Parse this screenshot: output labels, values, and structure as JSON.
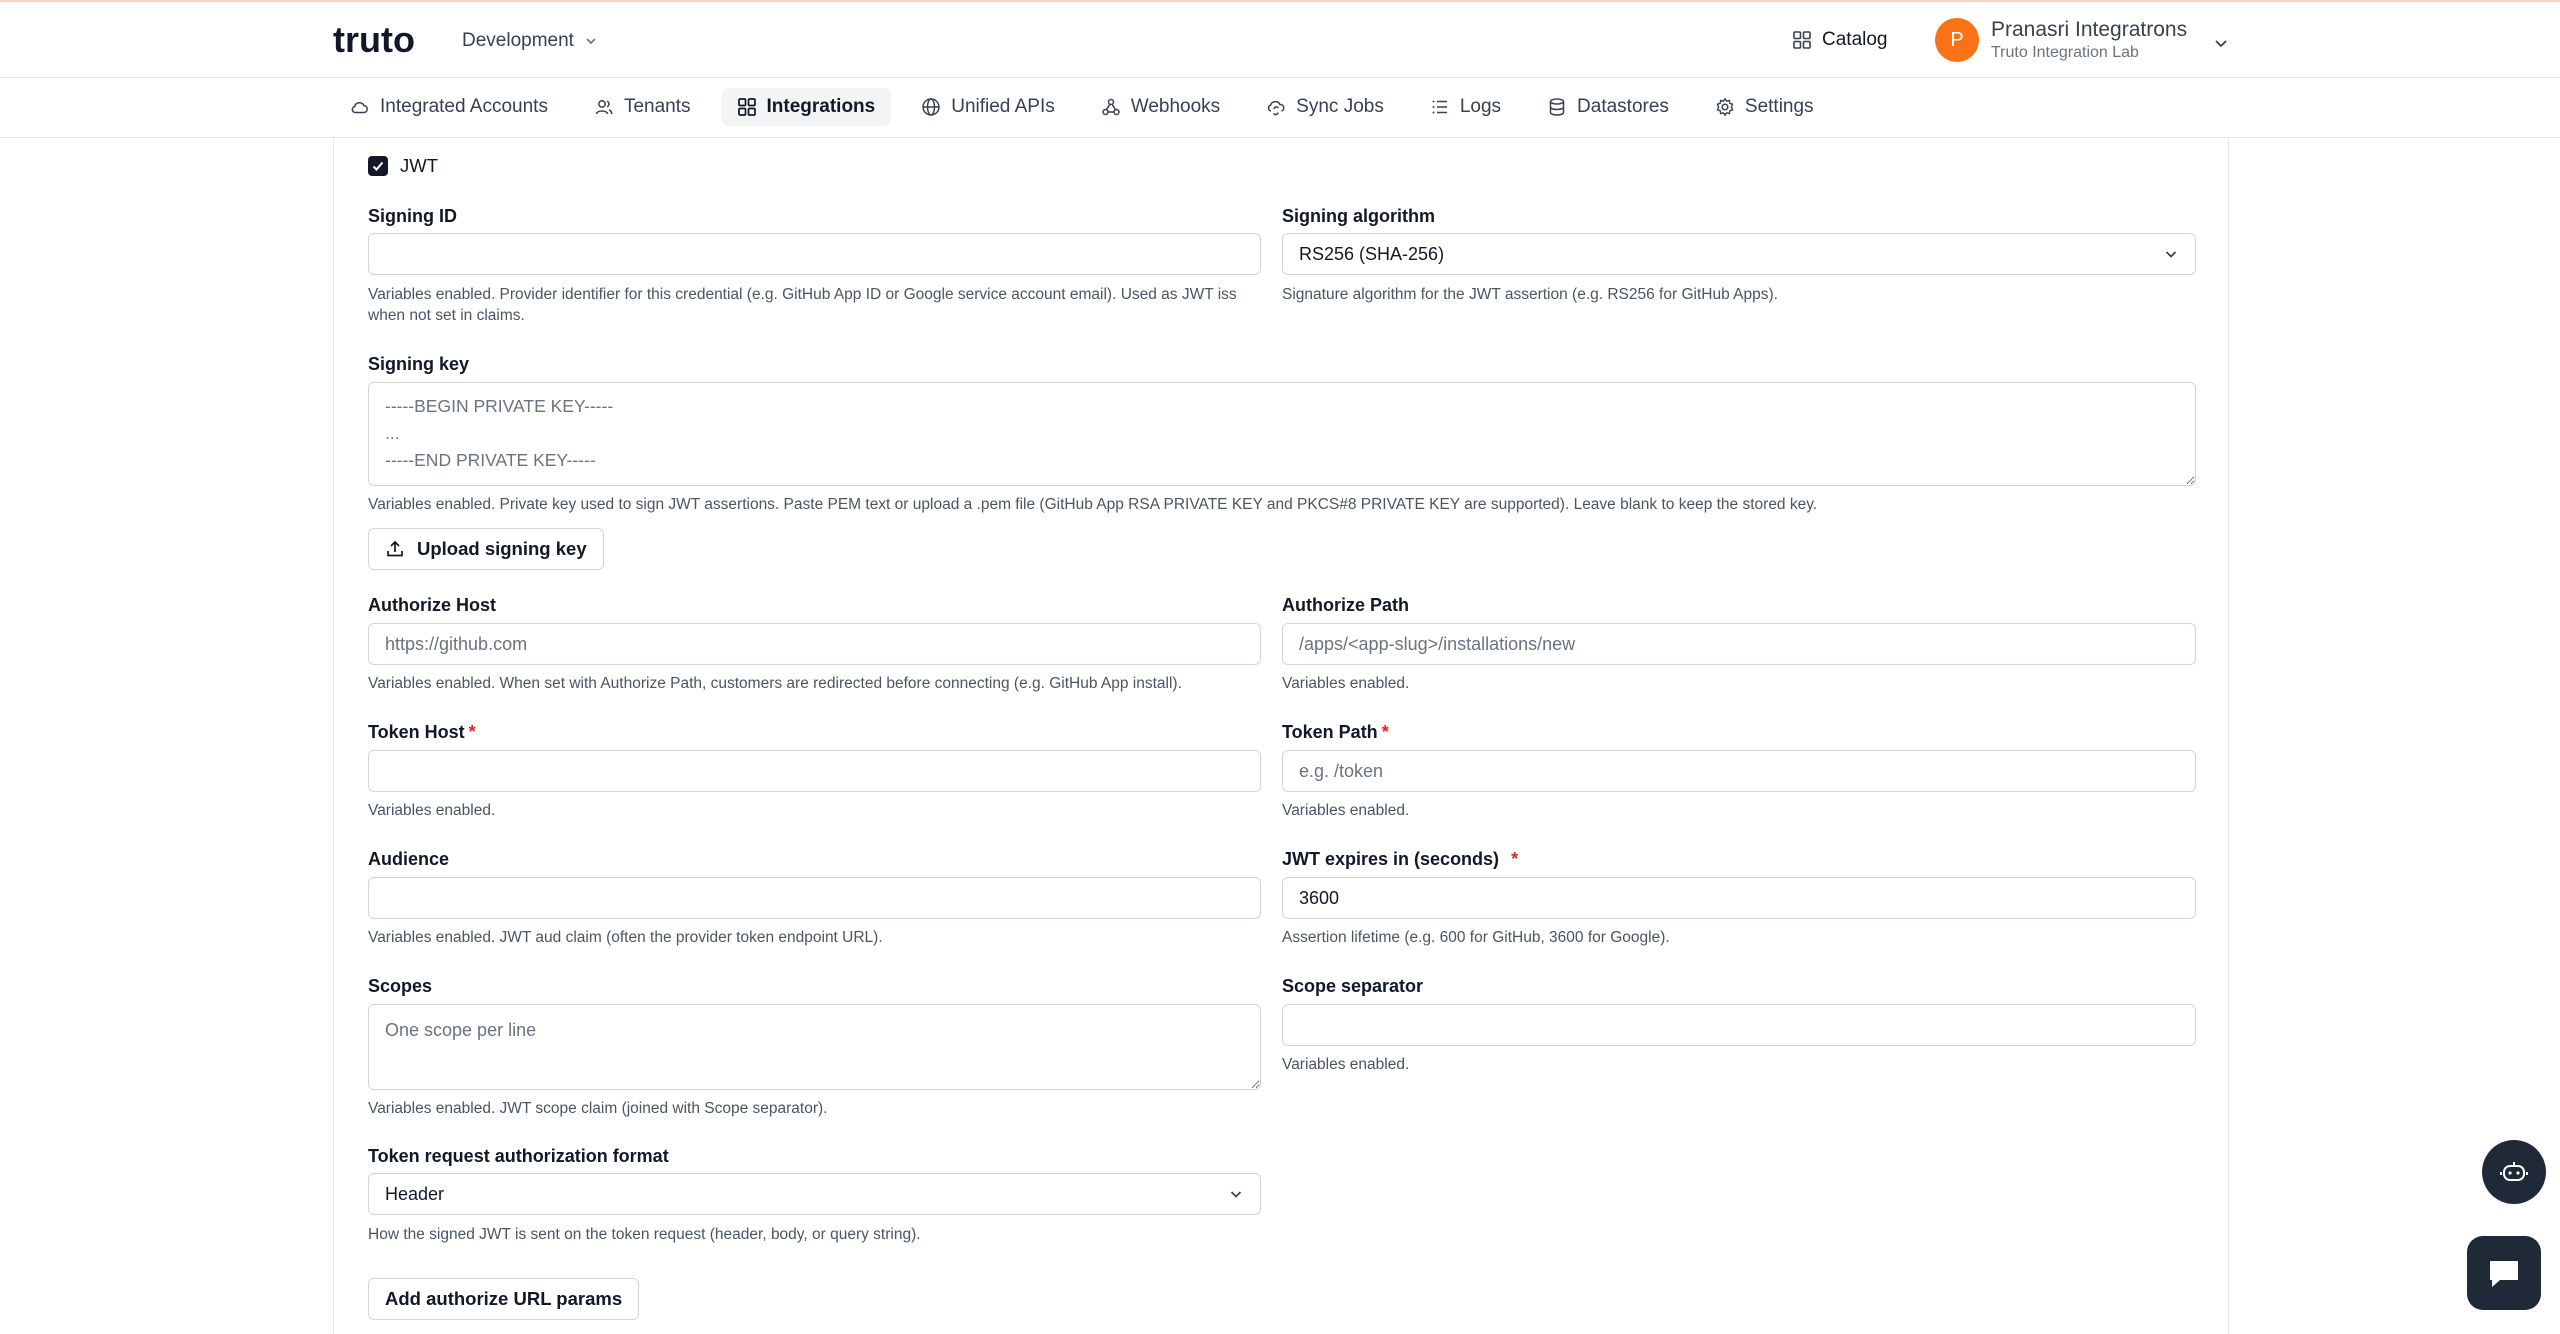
{
  "header": {
    "logo": "truto",
    "environment": "Development",
    "catalog_label": "Catalog",
    "user": {
      "initial": "P",
      "name": "Pranasri Integratrons",
      "org": "Truto Integration Lab"
    }
  },
  "nav": {
    "items": [
      {
        "label": "Integrated Accounts",
        "icon": "cloud-icon"
      },
      {
        "label": "Tenants",
        "icon": "users-icon"
      },
      {
        "label": "Integrations",
        "icon": "grid-icon",
        "active": true
      },
      {
        "label": "Unified APIs",
        "icon": "globe-icon"
      },
      {
        "label": "Webhooks",
        "icon": "webhook-icon"
      },
      {
        "label": "Sync Jobs",
        "icon": "sync-cloud-icon"
      },
      {
        "label": "Logs",
        "icon": "list-icon"
      },
      {
        "label": "Datastores",
        "icon": "database-icon"
      },
      {
        "label": "Settings",
        "icon": "gear-icon"
      }
    ]
  },
  "form": {
    "jwt_checkbox": {
      "label": "JWT",
      "checked": true
    },
    "signing_id": {
      "label": "Signing ID",
      "value": "",
      "placeholder": "",
      "help": "Variables enabled. Provider identifier for this credential (e.g. GitHub App ID or Google service account email). Used as JWT iss when not set in claims."
    },
    "signing_algorithm": {
      "label": "Signing algorithm",
      "value": "RS256 (SHA-256)",
      "help": "Signature algorithm for the JWT assertion (e.g. RS256 for GitHub Apps)."
    },
    "signing_key": {
      "label": "Signing key",
      "placeholder": "-----BEGIN PRIVATE KEY-----\n...\n-----END PRIVATE KEY-----",
      "help": "Variables enabled. Private key used to sign JWT assertions. Paste PEM text or upload a .pem file (GitHub App RSA PRIVATE KEY and PKCS#8 PRIVATE KEY are supported). Leave blank to keep the stored key."
    },
    "upload_button": "Upload signing key",
    "authorize_host": {
      "label": "Authorize Host",
      "placeholder": "https://github.com",
      "help": "Variables enabled. When set with Authorize Path, customers are redirected before connecting (e.g. GitHub App install)."
    },
    "authorize_path": {
      "label": "Authorize Path",
      "placeholder": "/apps/<app-slug>/installations/new",
      "help": "Variables enabled."
    },
    "token_host": {
      "label": "Token Host",
      "required": "*",
      "placeholder": "",
      "help": "Variables enabled."
    },
    "token_path": {
      "label": "Token Path",
      "required": "*",
      "placeholder": "e.g. /token",
      "help": "Variables enabled."
    },
    "audience": {
      "label": "Audience",
      "placeholder": "",
      "help": "Variables enabled. JWT aud claim (often the provider token endpoint URL)."
    },
    "jwt_expires": {
      "label": "JWT expires in (seconds)",
      "required": "*",
      "value": "3600",
      "help": "Assertion lifetime (e.g. 600 for GitHub, 3600 for Google)."
    },
    "scopes": {
      "label": "Scopes",
      "placeholder": "One scope per line",
      "help": "Variables enabled. JWT scope claim (joined with Scope separator)."
    },
    "scope_separator": {
      "label": "Scope separator",
      "placeholder": "",
      "help": "Variables enabled."
    },
    "token_request_format": {
      "label": "Token request authorization format",
      "value": "Header",
      "help": "How the signed JWT is sent on the token request (header, body, or query string)."
    },
    "add_params_button": "Add authorize URL params"
  },
  "colors": {
    "accent": "#f97316",
    "required": "#dc2626",
    "fab": "#1f2937"
  }
}
